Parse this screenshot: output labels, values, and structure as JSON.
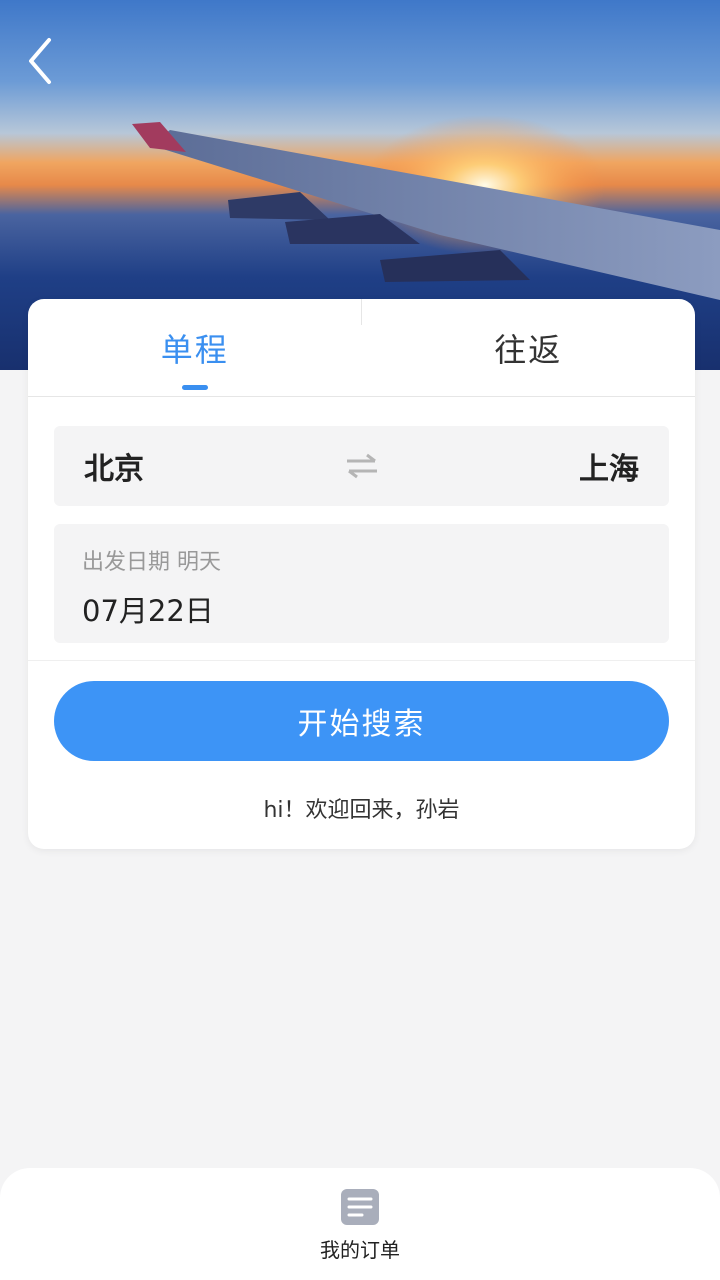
{
  "header": {
    "back_icon": "chevron-left-icon"
  },
  "tabs": [
    {
      "label": "单程",
      "active": true
    },
    {
      "label": "往返",
      "active": false
    }
  ],
  "route": {
    "from": "北京",
    "to": "上海",
    "swap_icon": "swap-arrows-icon"
  },
  "date": {
    "label": "出发日期 明天",
    "value": "07月22日"
  },
  "search": {
    "label": "开始搜索"
  },
  "welcome": {
    "text": "hi！欢迎回来，孙岩"
  },
  "bottom_nav": {
    "orders_label": "我的订单",
    "orders_icon": "document-list-icon"
  },
  "colors": {
    "accent": "#3d94f6",
    "tab_active": "#3a8ff0",
    "background": "#f4f4f5"
  }
}
